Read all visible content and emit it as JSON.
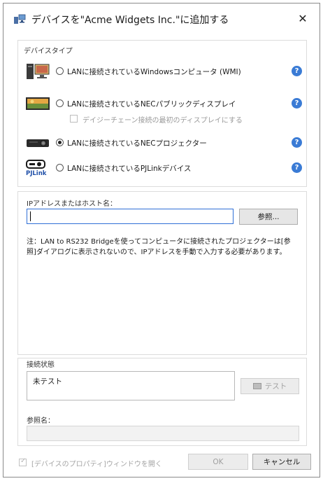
{
  "window": {
    "title": "デバイスを\"Acme Widgets Inc.\"に追加する",
    "close_glyph": "✕"
  },
  "device_type": {
    "label": "デバイスタイプ",
    "options": [
      {
        "label": "LANに接続されているWindowsコンピュータ (WMI)",
        "icon": "computer-icon",
        "selected": false
      },
      {
        "label": "LANに接続されているNECパブリックディスプレイ",
        "icon": "display-icon",
        "selected": false
      },
      {
        "label": "LANに接続されているNECプロジェクター",
        "icon": "projector-icon",
        "selected": true
      },
      {
        "label": "LANに接続されているPJLinkデバイス",
        "icon": "pjlink-icon",
        "icon_text": "PJLink",
        "selected": false
      }
    ],
    "daisy_chain_label": "デイジーチェーン接続の最初のディスプレイにする",
    "help_glyph": "?"
  },
  "ip_section": {
    "label": "IPアドレスまたはホスト名：",
    "value": "",
    "browse_label": "参照...",
    "note": "注：LAN to RS232 Bridgeを使ってコンピュータに接続されたプロジェクターは[参照]ダイアログに表示されないので、IPアドレスを手動で入力する必要があります。"
  },
  "connection": {
    "label": "接続状態",
    "status": "未テスト",
    "test_label": "テスト",
    "ref_label": "参照名：",
    "ref_value": ""
  },
  "footer": {
    "open_props_label": "[デバイスのプロパティ]ウィンドウを開く",
    "ok_label": "OK",
    "cancel_label": "キャンセル"
  },
  "colors": {
    "accent": "#2f6fd6",
    "help": "#3a7bd5"
  }
}
